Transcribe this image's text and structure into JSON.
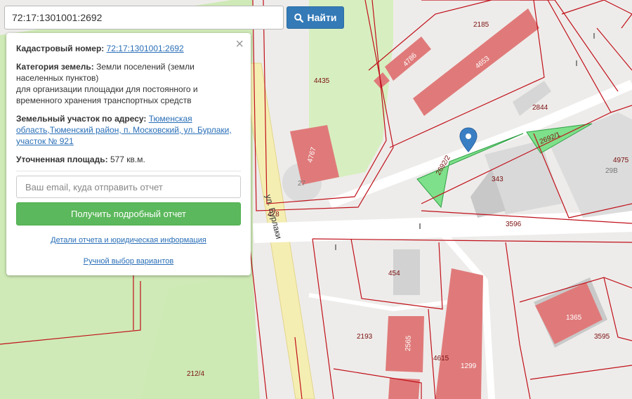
{
  "search": {
    "value": "72:17:1301001:2692",
    "button_label": "Найти"
  },
  "info": {
    "cadastral_label": "Кадастровый номер:",
    "cadastral_value": "72:17:1301001:2692",
    "category_label": "Категория земель:",
    "category_value": "Земли поселений (земли населенных пунктов)",
    "category_purpose": "для организации площадки для постоянного и временного хранения транспортных средств",
    "address_label": "Земельный участок по адресу:",
    "address_value": "Тюменская область,Тюменский район, п. Московский, ул. Бурлаки, участок № 921",
    "area_label": "Уточненная площадь:",
    "area_value": "577 кв.м.",
    "email_placeholder": "Ваш email, куда отправить отчет",
    "report_button": "Получить подробный отчет",
    "details_link": "Детали отчета и юридическая информация",
    "manual_link": "Ручной выбор вариантов",
    "close_symbol": "×"
  },
  "map": {
    "street_label": "ул. Бурлаки",
    "parcel_labels": [
      "2185",
      "4435",
      "2844",
      "4975",
      "29В",
      "478",
      "3596",
      "2193",
      "4615",
      "3595",
      "212/4",
      "343"
    ],
    "building_labels": [
      "4786",
      "4653",
      "4767",
      "454",
      "2565",
      "1299",
      "1365",
      "2692/2",
      "2692/1",
      "27"
    ],
    "colors": {
      "building": "#e07a7a",
      "parcel_border": "#c0101a",
      "selected_parcel": "#7ee08a",
      "green_area": "#cfeab6",
      "road": "#f5eeb3",
      "marker": "#3a7fc4"
    }
  }
}
